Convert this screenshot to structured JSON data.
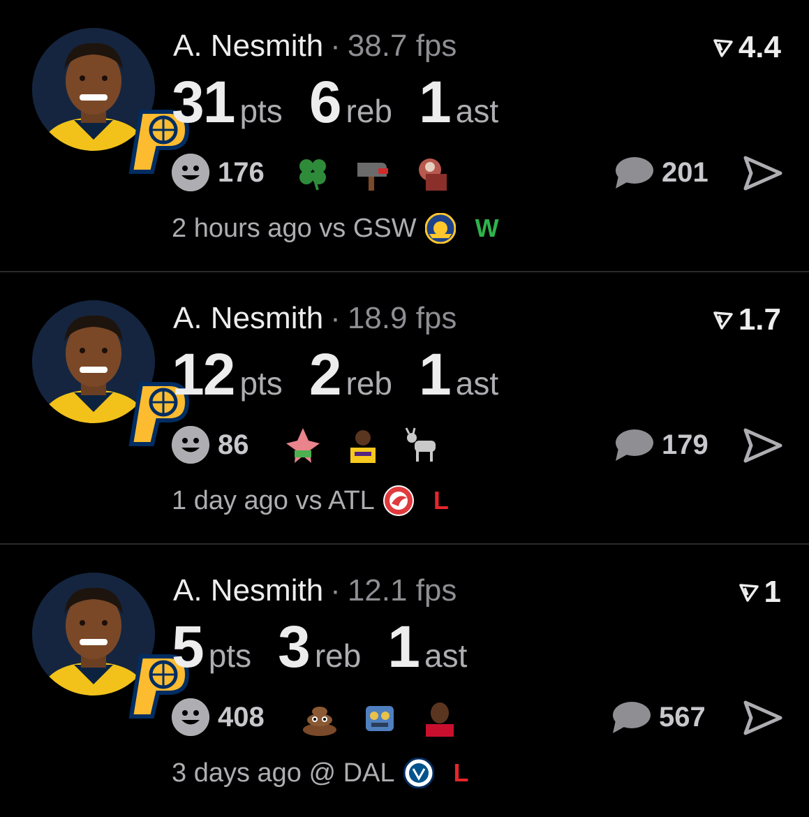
{
  "posts": [
    {
      "player": "A. Nesmith",
      "separator": "·",
      "fps": "38.7 fps",
      "rating": "4.4",
      "stats": [
        {
          "value": "31",
          "unit": "pts"
        },
        {
          "value": "6",
          "unit": "reb"
        },
        {
          "value": "1",
          "unit": "ast"
        }
      ],
      "reactions": "176",
      "emojis": [
        "four-leaf-clover",
        "mailbox",
        "reaction-sticker"
      ],
      "comments": "201",
      "time": "2 hours ago",
      "matchup": "vs GSW",
      "opponent_logo": "warriors-logo",
      "result": "W",
      "result_color": "#2fb24c"
    },
    {
      "player": "A. Nesmith",
      "separator": "·",
      "fps": "18.9 fps",
      "rating": "1.7",
      "stats": [
        {
          "value": "12",
          "unit": "pts"
        },
        {
          "value": "2",
          "unit": "reb"
        },
        {
          "value": "1",
          "unit": "ast"
        }
      ],
      "reactions": "86",
      "emojis": [
        "patrick-sticker",
        "lebron-sticker",
        "goat"
      ],
      "comments": "179",
      "time": "1 day ago",
      "matchup": "vs ATL",
      "opponent_logo": "hawks-logo",
      "result": "L",
      "result_color": "#e5262b"
    },
    {
      "player": "A. Nesmith",
      "separator": "·",
      "fps": "12.1 fps",
      "rating": "1",
      "stats": [
        {
          "value": "5",
          "unit": "pts"
        },
        {
          "value": "3",
          "unit": "reb"
        },
        {
          "value": "1",
          "unit": "ast"
        }
      ],
      "reactions": "408",
      "emojis": [
        "poop",
        "robot",
        "kawhi-sticker"
      ],
      "comments": "567",
      "time": "3 days ago",
      "matchup": "@ DAL",
      "opponent_logo": "mavericks-logo",
      "result": "L",
      "result_color": "#e5262b"
    }
  ],
  "colors": {
    "background": "#000000",
    "primary_text": "#ededed",
    "secondary_text": "#8e8e93",
    "win": "#2fb24c",
    "loss": "#e5262b"
  }
}
